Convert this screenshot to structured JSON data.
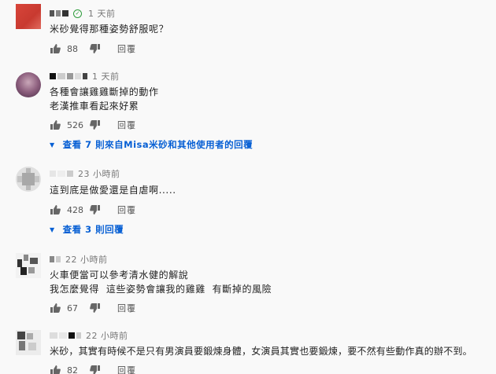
{
  "comments": [
    {
      "time": "1 天前",
      "lines": [
        "米砂覺得那種姿勢舒服呢？"
      ],
      "likes": "88",
      "reply_label": "回覆",
      "verified": true
    },
    {
      "time": "1 天前",
      "lines": [
        "各種會讓雞雞斷掉的動作",
        "老漢推車看起來好累"
      ],
      "likes": "526",
      "reply_label": "回覆",
      "view_replies": "查看 7 則來自Misa米砂和其他使用者的回覆"
    },
    {
      "time": "23 小時前",
      "lines": [
        "這到底是做愛還是自虐啊....."
      ],
      "likes": "428",
      "reply_label": "回覆",
      "view_replies": "查看 3 則回覆"
    },
    {
      "time": "22 小時前",
      "lines": [
        "火車便當可以參考清水健的解說",
        "我怎麼覺得  這些姿勢會讓我的雞雞  有斷掉的風險"
      ],
      "likes": "67",
      "reply_label": "回覆"
    },
    {
      "time": "22 小時前",
      "lines": [
        "米砂，其實有時候不是只有男演員要鍛煉身體，女演員其實也要鍛煉，要不然有些動作真的辦不到。"
      ],
      "likes": "82",
      "reply_label": "回覆"
    }
  ],
  "colors": {
    "link": "#065fd4",
    "verified": "#2e9c3c",
    "icon": "#666666"
  }
}
